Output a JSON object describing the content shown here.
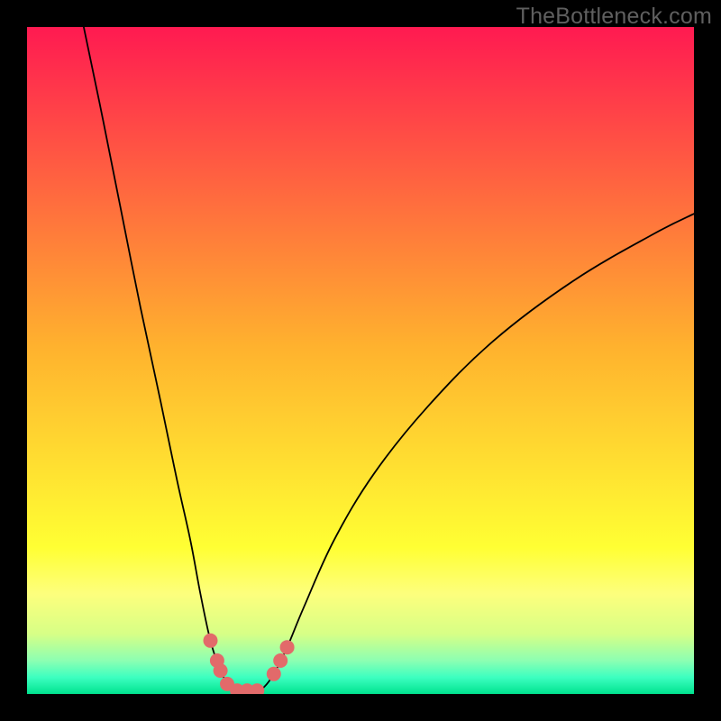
{
  "watermark": "TheBottleneck.com",
  "chart_data": {
    "type": "line",
    "title": "",
    "xlabel": "",
    "ylabel": "",
    "xlim": [
      0,
      100
    ],
    "ylim": [
      0,
      100
    ],
    "grid": false,
    "legend": false,
    "background_gradient": {
      "stops": [
        {
          "offset": 0.0,
          "color": "#ff1a51"
        },
        {
          "offset": 0.48,
          "color": "#ffb22e"
        },
        {
          "offset": 0.78,
          "color": "#ffff33"
        },
        {
          "offset": 0.85,
          "color": "#fdff7d"
        },
        {
          "offset": 0.91,
          "color": "#d7ff86"
        },
        {
          "offset": 0.95,
          "color": "#8cffb2"
        },
        {
          "offset": 0.975,
          "color": "#3dffc0"
        },
        {
          "offset": 1.0,
          "color": "#00e38f"
        }
      ]
    },
    "series": [
      {
        "name": "curve",
        "stroke": "#000000",
        "stroke_width": 1.8,
        "points": [
          {
            "x": 8.5,
            "y": 100.0
          },
          {
            "x": 11.0,
            "y": 88.0
          },
          {
            "x": 14.0,
            "y": 73.0
          },
          {
            "x": 17.0,
            "y": 58.0
          },
          {
            "x": 20.0,
            "y": 44.0
          },
          {
            "x": 22.5,
            "y": 32.0
          },
          {
            "x": 24.5,
            "y": 23.0
          },
          {
            "x": 26.0,
            "y": 15.0
          },
          {
            "x": 27.5,
            "y": 8.0
          },
          {
            "x": 29.0,
            "y": 3.5
          },
          {
            "x": 30.5,
            "y": 1.0
          },
          {
            "x": 32.0,
            "y": 0.2
          },
          {
            "x": 34.0,
            "y": 0.2
          },
          {
            "x": 35.5,
            "y": 1.0
          },
          {
            "x": 37.0,
            "y": 3.0
          },
          {
            "x": 39.0,
            "y": 7.0
          },
          {
            "x": 41.5,
            "y": 13.0
          },
          {
            "x": 46.0,
            "y": 23.0
          },
          {
            "x": 52.0,
            "y": 33.0
          },
          {
            "x": 60.0,
            "y": 43.0
          },
          {
            "x": 70.0,
            "y": 53.0
          },
          {
            "x": 82.0,
            "y": 62.0
          },
          {
            "x": 94.0,
            "y": 69.0
          },
          {
            "x": 100.0,
            "y": 72.0
          }
        ]
      }
    ],
    "markers": {
      "name": "dots",
      "color": "#e26a6a",
      "radius": 8,
      "points": [
        {
          "x": 27.5,
          "y": 8.0
        },
        {
          "x": 28.5,
          "y": 5.0
        },
        {
          "x": 29.0,
          "y": 3.5
        },
        {
          "x": 30.0,
          "y": 1.5
        },
        {
          "x": 31.5,
          "y": 0.5
        },
        {
          "x": 33.0,
          "y": 0.5
        },
        {
          "x": 34.5,
          "y": 0.5
        },
        {
          "x": 37.0,
          "y": 3.0
        },
        {
          "x": 38.0,
          "y": 5.0
        },
        {
          "x": 39.0,
          "y": 7.0
        }
      ]
    }
  }
}
